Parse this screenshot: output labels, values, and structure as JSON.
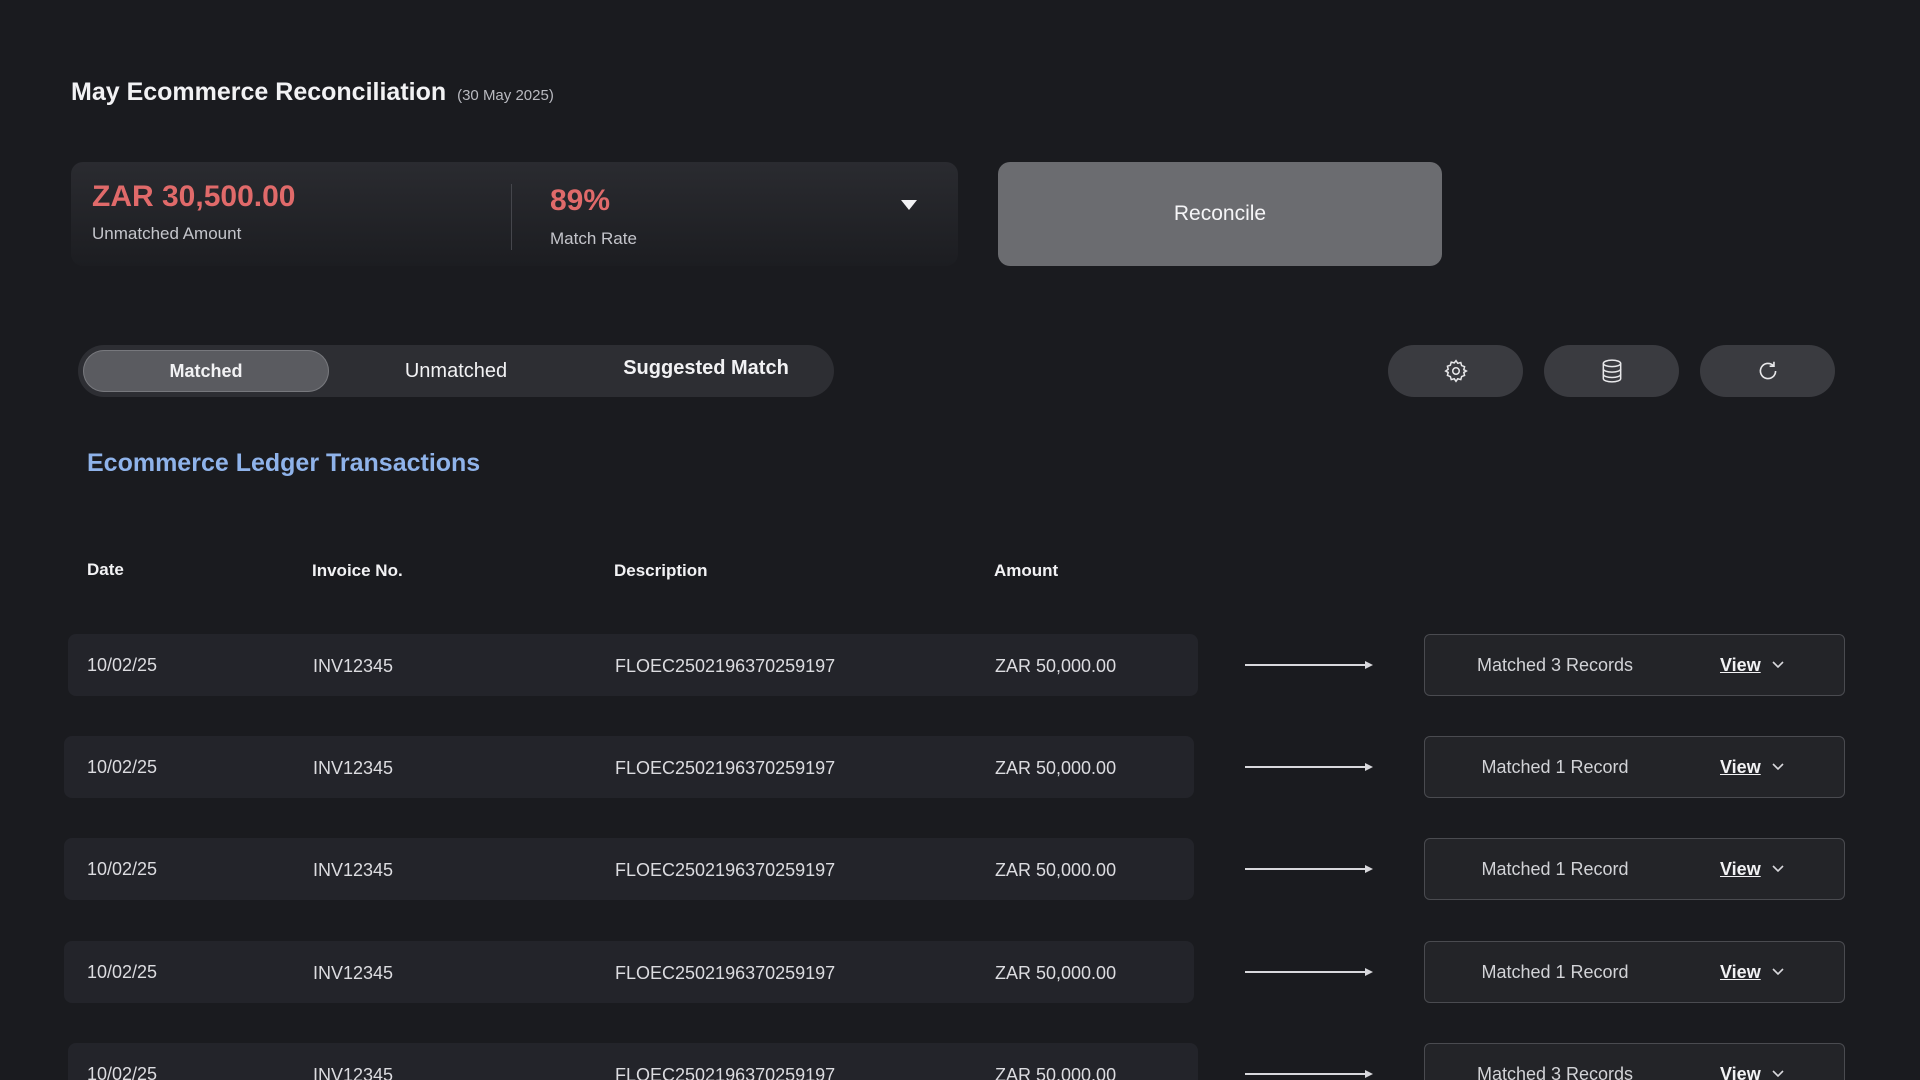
{
  "header": {
    "title": "May Ecommerce Reconciliation",
    "date": "(30 May 2025)"
  },
  "summary": {
    "unmatched_amount": "ZAR 30,500.00",
    "unmatched_label": "Unmatched Amount",
    "match_rate": "89%",
    "match_rate_label": "Match Rate",
    "accent_color": "#e06a6a"
  },
  "reconcile_label": "Reconcile",
  "tabs": [
    {
      "label": "Matched",
      "active": true
    },
    {
      "label": "Unmatched",
      "active": false
    },
    {
      "label": "Suggested Match",
      "active": false
    }
  ],
  "tools": [
    "gear-icon",
    "database-icon",
    "refresh-icon"
  ],
  "section_title": "Ecommerce Ledger Transactions",
  "table": {
    "headers": [
      "Date",
      "Invoice No.",
      "Description",
      "Amount"
    ],
    "rows": [
      {
        "date": "10/02/25",
        "invoice": "INV12345",
        "description": "FLOEC2502196370259197",
        "amount": "ZAR 50,000.00",
        "match": "Matched 3 Records",
        "action": "View"
      },
      {
        "date": "10/02/25",
        "invoice": "INV12345",
        "description": "FLOEC2502196370259197",
        "amount": "ZAR 50,000.00",
        "match": "Matched 1 Record",
        "action": "View"
      },
      {
        "date": "10/02/25",
        "invoice": "INV12345",
        "description": "FLOEC2502196370259197",
        "amount": "ZAR 50,000.00",
        "match": "Matched 1 Record",
        "action": "View"
      },
      {
        "date": "10/02/25",
        "invoice": "INV12345",
        "description": "FLOEC2502196370259197",
        "amount": "ZAR 50,000.00",
        "match": "Matched 1 Record",
        "action": "View"
      },
      {
        "date": "10/02/25",
        "invoice": "INV12345",
        "description": "FLOEC2502196370259197",
        "amount": "ZAR 50,000.00",
        "match": "Matched 3 Records",
        "action": "View"
      }
    ]
  },
  "colors": {
    "background": "#1a1b1f",
    "link_blue": "#8fb3ea",
    "card": "#23242a"
  }
}
